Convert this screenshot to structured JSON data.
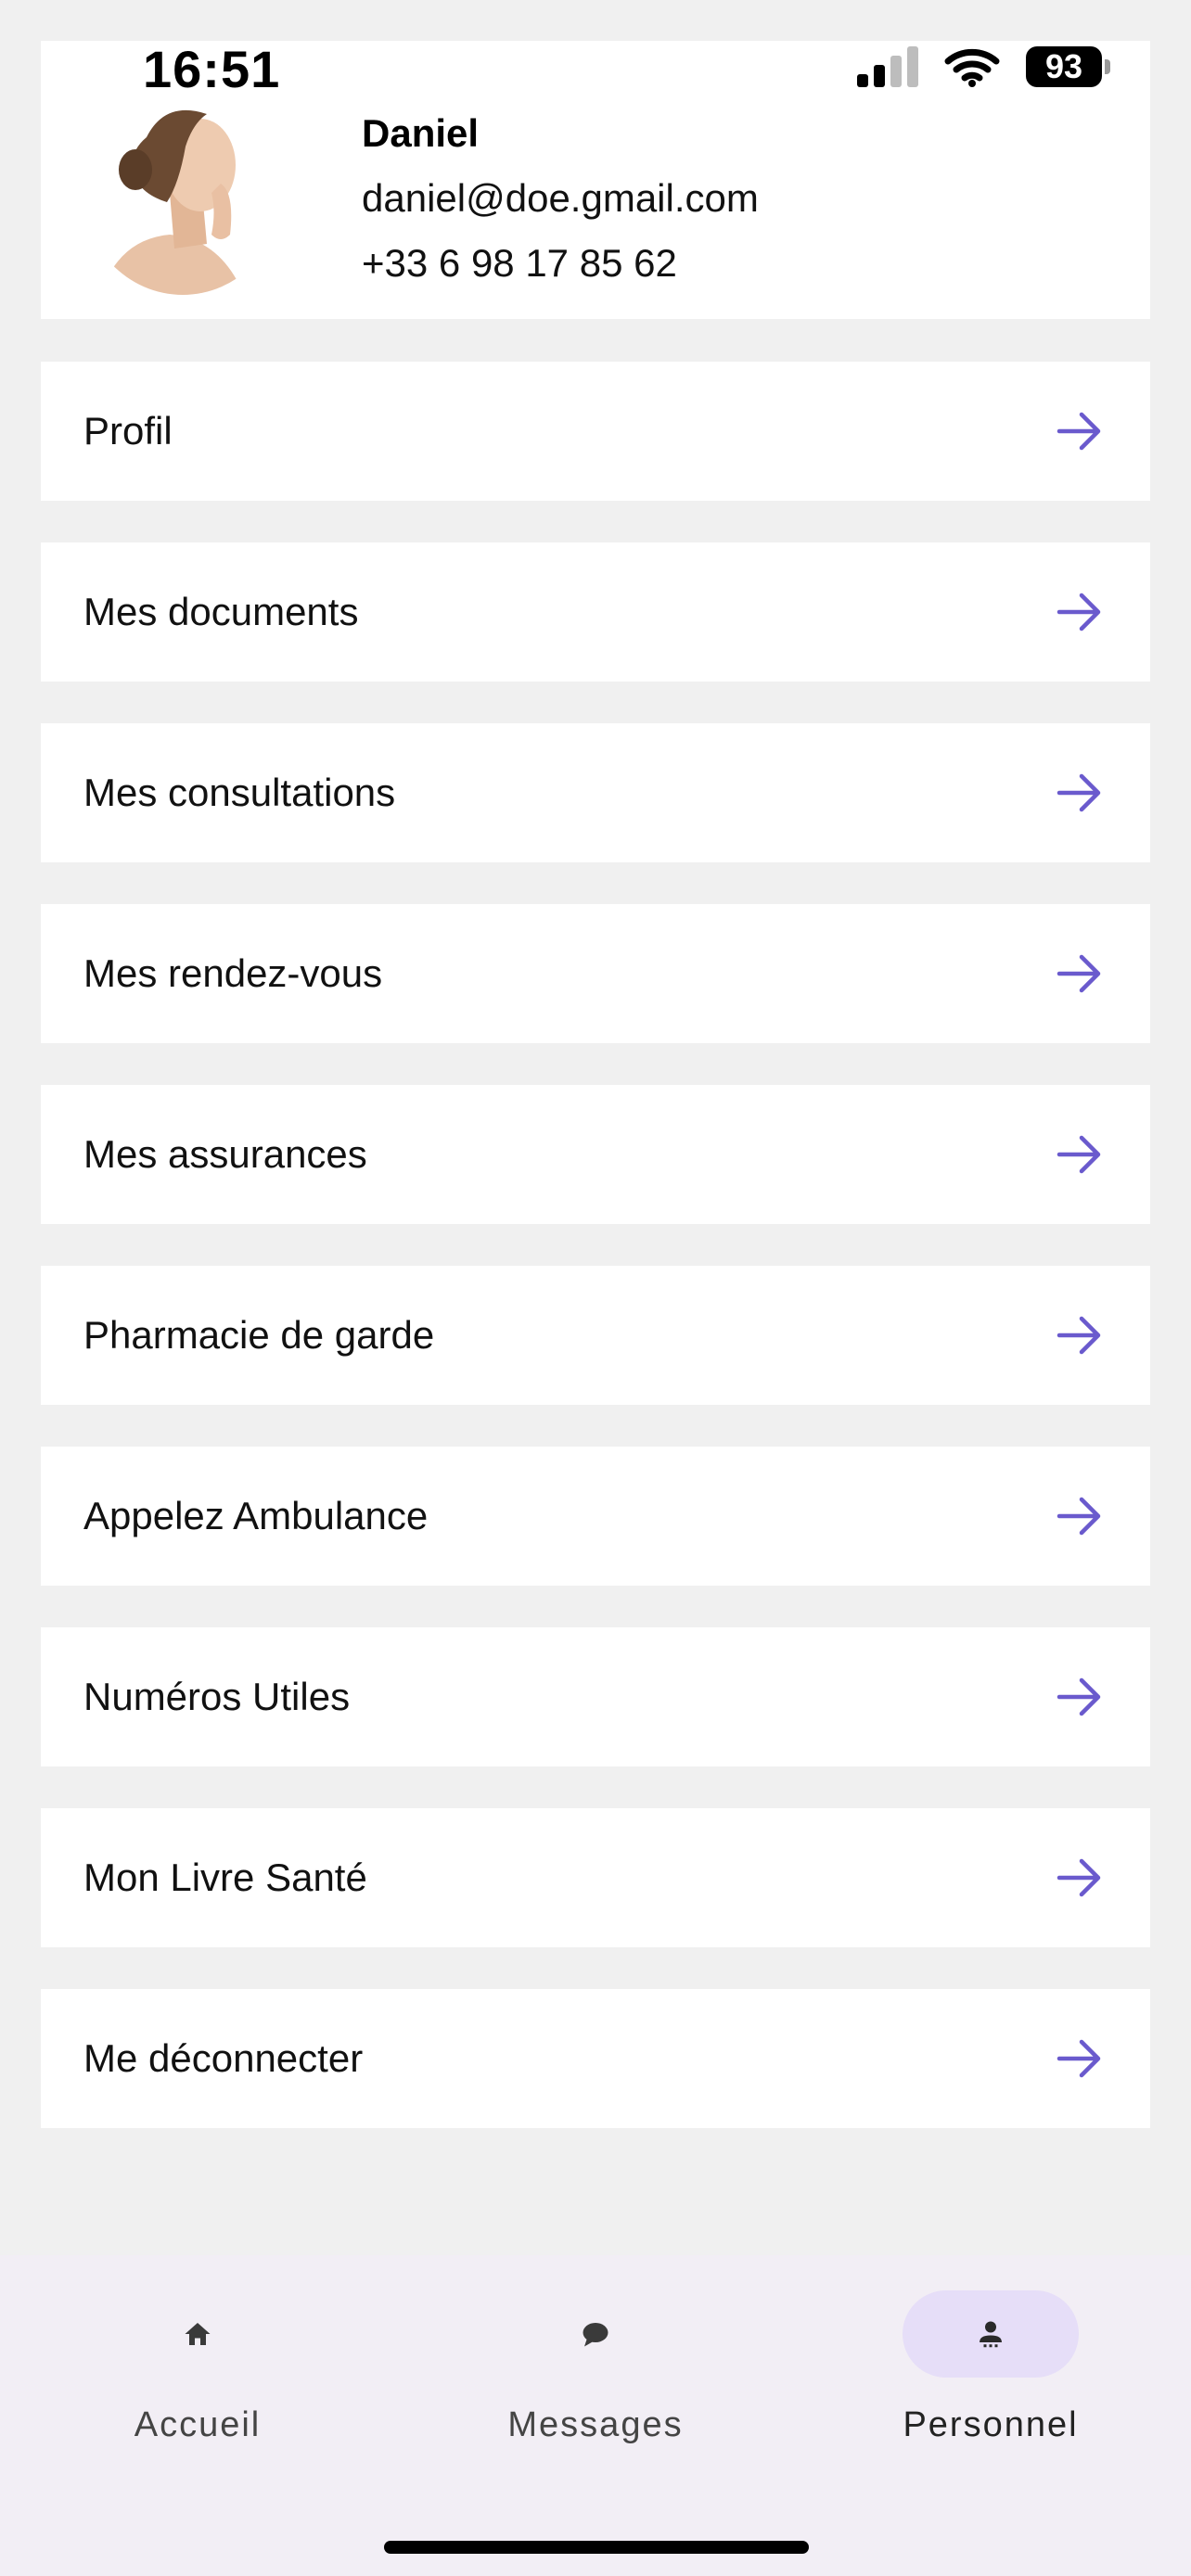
{
  "status_bar": {
    "time": "16:51",
    "battery": "93"
  },
  "profile": {
    "name": "Daniel",
    "email": "daniel@doe.gmail.com",
    "phone": "+33 6 98 17 85 62"
  },
  "menu": {
    "items": [
      {
        "label": "Profil",
        "icon": "arrow-right-icon"
      },
      {
        "label": "Mes documents",
        "icon": "arrow-right-icon"
      },
      {
        "label": "Mes consultations",
        "icon": "arrow-right-icon"
      },
      {
        "label": "Mes rendez-vous",
        "icon": "arrow-right-icon"
      },
      {
        "label": "Mes assurances",
        "icon": "arrow-right-icon"
      },
      {
        "label": "Pharmacie de garde",
        "icon": "arrow-right-icon"
      },
      {
        "label": "Appelez Ambulance",
        "icon": "arrow-right-icon"
      },
      {
        "label": "Numéros Utiles",
        "icon": "arrow-right-icon"
      },
      {
        "label": "Mon Livre Santé",
        "icon": "arrow-right-icon"
      },
      {
        "label": "Me déconnecter",
        "icon": "arrow-right-icon"
      }
    ]
  },
  "bottom_nav": {
    "tabs": [
      {
        "label": "Accueil",
        "icon": "home-icon",
        "active": false
      },
      {
        "label": "Messages",
        "icon": "chat-bubble-icon",
        "active": false
      },
      {
        "label": "Personnel",
        "icon": "person-icon",
        "active": true
      }
    ]
  },
  "colors": {
    "accent": "#6a5acd",
    "background": "#f0f0f0",
    "nav_background": "#f2eef5",
    "active_pill": "#e6def8"
  }
}
